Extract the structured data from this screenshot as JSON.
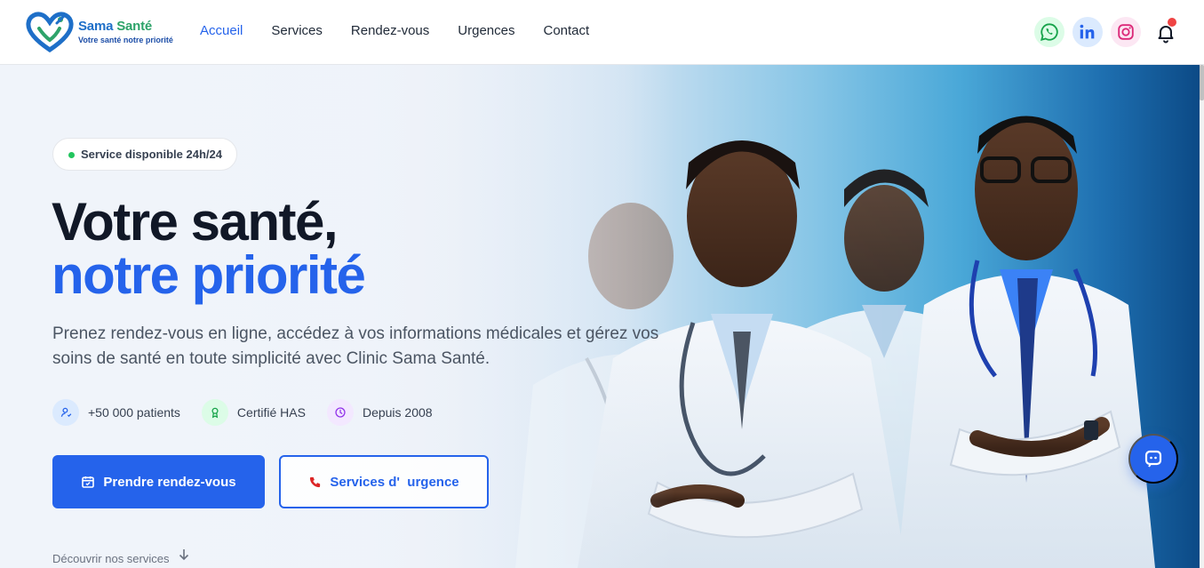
{
  "brand": {
    "name_part1": "Sama",
    "name_part2": "Santé",
    "tagline": "Votre santé notre priorité",
    "colors": {
      "primary": "#2563eb",
      "brand_blue": "#1e6fc8",
      "brand_green": "#2ea36a"
    }
  },
  "nav": {
    "items": [
      {
        "label": "Accueil",
        "active": true
      },
      {
        "label": "Services",
        "active": false
      },
      {
        "label": "Rendez-vous",
        "active": false
      },
      {
        "label": "Urgences",
        "active": false
      },
      {
        "label": "Contact",
        "active": false
      }
    ],
    "socials": [
      "whatsapp-icon",
      "linkedin-icon",
      "instagram-icon"
    ],
    "notification": {
      "icon": "bell-icon",
      "has_unread": true
    }
  },
  "hero": {
    "badge": "Service disponible 24h/24",
    "title_line1": "Votre santé,",
    "title_line2": "notre priorité",
    "lead": "Prenez rendez-vous en ligne, accédez à vos informations médicales et gérez vos soins de santé en toute simplicité avec Clinic Sama Santé.",
    "stats": [
      {
        "icon": "user-icon",
        "label": "+50 000 patients"
      },
      {
        "icon": "award-icon",
        "label": "Certifié HAS"
      },
      {
        "icon": "clock-icon",
        "label": "Depuis 2008"
      }
    ],
    "primary_cta": "Prendre rendez-vous",
    "secondary_cta": "Services d'  urgence",
    "discover": "Découvrir nos services",
    "image": "team-of-doctors-photo"
  },
  "chat": {
    "icon": "chat-bot-icon"
  }
}
